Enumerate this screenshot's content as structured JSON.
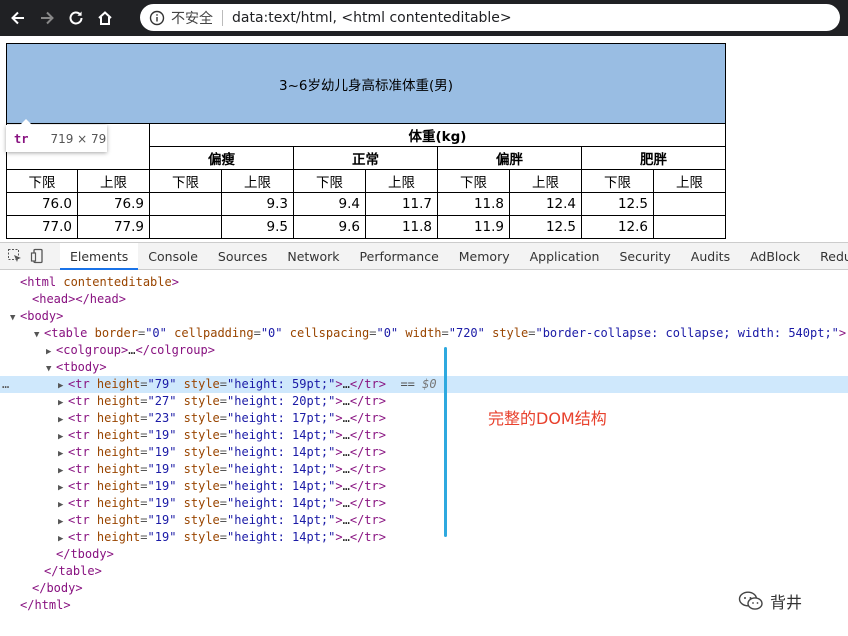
{
  "browser": {
    "insecure_label": "不安全",
    "url": "data:text/html, <html contenteditable>"
  },
  "page_table": {
    "title": "3~6岁幼儿身高标准体重(男)",
    "weight_header": "体重(kg)",
    "categories": [
      "偏瘦",
      "正常",
      "偏胖",
      "肥胖"
    ],
    "bounds": [
      "下限",
      "上限",
      "下限",
      "上限",
      "下限",
      "上限",
      "下限",
      "上限",
      "下限",
      "上限"
    ],
    "rows": [
      [
        "76.0",
        "76.9",
        "",
        "9.3",
        "9.4",
        "11.7",
        "11.8",
        "12.4",
        "12.5",
        ""
      ],
      [
        "77.0",
        "77.9",
        "",
        "9.5",
        "9.6",
        "11.8",
        "11.9",
        "12.5",
        "12.6",
        ""
      ]
    ]
  },
  "tooltip": {
    "tag": "tr",
    "size": "719 × 79"
  },
  "devtools": {
    "tabs": [
      "Elements",
      "Console",
      "Sources",
      "Network",
      "Performance",
      "Memory",
      "Application",
      "Security",
      "Audits",
      "AdBlock",
      "Redux"
    ],
    "active_tab": "Elements",
    "dom_lines": [
      "<html contenteditable>",
      "<head></head>",
      "<body>",
      "<table border=\"0\" cellpadding=\"0\" cellspacing=\"0\" width=\"720\" style=\"border-collapse: collapse; width: 540pt;\">",
      "<colgroup>…</colgroup>",
      "<tbody>",
      "<tr height=\"79\" style=\"height: 59pt;\">…</tr> == $0",
      "<tr height=\"27\" style=\"height: 20pt;\">…</tr>",
      "<tr height=\"23\" style=\"height: 17pt;\">…</tr>",
      "<tr height=\"19\" style=\"height: 14pt;\">…</tr>",
      "<tr height=\"19\" style=\"height: 14pt;\">…</tr>",
      "<tr height=\"19\" style=\"height: 14pt;\">…</tr>",
      "<tr height=\"19\" style=\"height: 14pt;\">…</tr>",
      "<tr height=\"19\" style=\"height: 14pt;\">…</tr>",
      "<tr height=\"19\" style=\"height: 14pt;\">…</tr>",
      "<tr height=\"19\" style=\"height: 14pt;\">…</tr>",
      "</tbody>",
      "</table>",
      "</body>",
      "</html>"
    ]
  },
  "annotation": "完整的DOM结构",
  "watermark": "背井",
  "colors": {
    "title_bg": "#99bde3",
    "selected_row": "#cfe8fc",
    "annotation": "#e8412d",
    "marker_line": "#2ea9df",
    "active_tab_underline": "#1a73e8"
  }
}
